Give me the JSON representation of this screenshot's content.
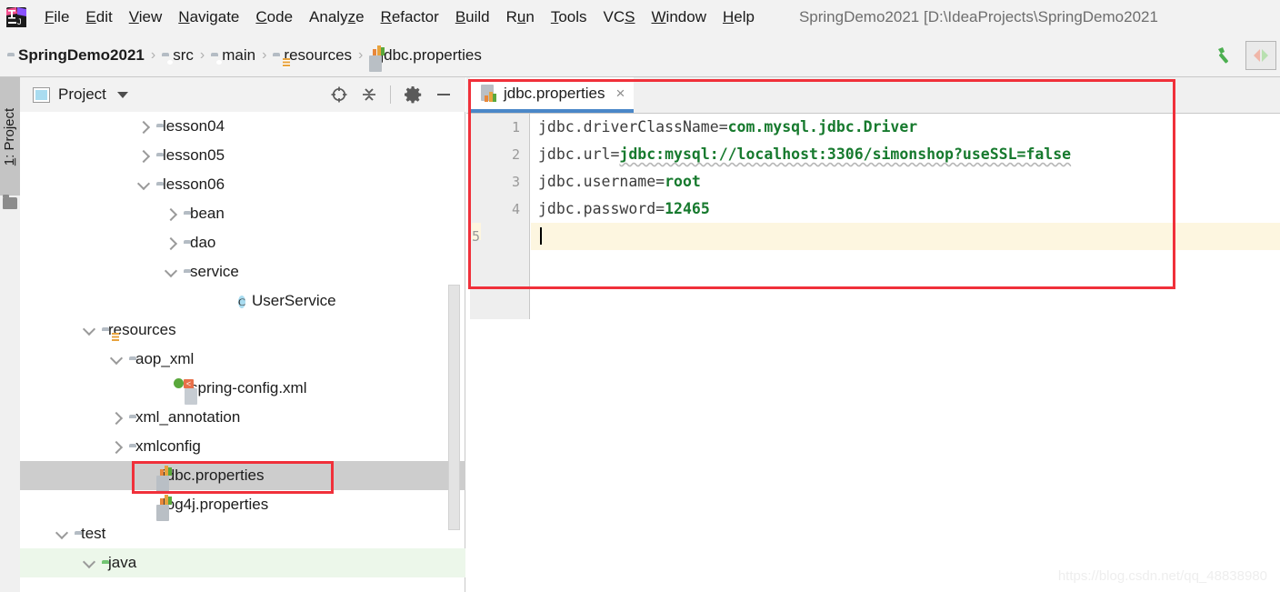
{
  "window": {
    "title": "SpringDemo2021 [D:\\IdeaProjects\\SpringDemo2021",
    "app_icon": "intellij-idea-logo"
  },
  "menubar": {
    "items": [
      {
        "label": "File",
        "mnemonic": "F"
      },
      {
        "label": "Edit",
        "mnemonic": "E"
      },
      {
        "label": "View",
        "mnemonic": "V"
      },
      {
        "label": "Navigate",
        "mnemonic": "N"
      },
      {
        "label": "Code",
        "mnemonic": "C"
      },
      {
        "label": "Analyze",
        "mnemonic": "z"
      },
      {
        "label": "Refactor",
        "mnemonic": "R"
      },
      {
        "label": "Build",
        "mnemonic": "B"
      },
      {
        "label": "Run",
        "mnemonic": "u"
      },
      {
        "label": "Tools",
        "mnemonic": "T"
      },
      {
        "label": "VCS",
        "mnemonic": "S"
      },
      {
        "label": "Window",
        "mnemonic": "W"
      },
      {
        "label": "Help",
        "mnemonic": "H"
      }
    ]
  },
  "navbar": {
    "crumbs": [
      {
        "label": "SpringDemo2021",
        "icon": "module-icon",
        "bold": true
      },
      {
        "label": "src",
        "icon": "folder-icon",
        "bold": false
      },
      {
        "label": "main",
        "icon": "folder-icon",
        "bold": false
      },
      {
        "label": "resources",
        "icon": "resources-icon",
        "bold": false
      },
      {
        "label": "jdbc.properties",
        "icon": "properties-icon",
        "bold": false
      }
    ],
    "separator": "›",
    "actions": [
      {
        "name": "build-hammer-icon"
      },
      {
        "name": "navigate-arrows-button"
      }
    ]
  },
  "toolstrip": {
    "project_tab": "1: Project",
    "project_tab_mnemonic": "1"
  },
  "project_panel": {
    "title": "Project",
    "actions": [
      {
        "name": "locate-target-icon"
      },
      {
        "name": "collapse-all-icon"
      },
      {
        "name": "settings-gear-icon"
      },
      {
        "name": "hide-minimize-icon"
      }
    ],
    "tree": [
      {
        "label": "lesson04",
        "icon": "folder-icon",
        "arrow": "right",
        "indent": 4,
        "state": "normal"
      },
      {
        "label": "lesson05",
        "icon": "folder-icon",
        "arrow": "right",
        "indent": 4,
        "state": "normal"
      },
      {
        "label": "lesson06",
        "icon": "folder-icon",
        "arrow": "down",
        "indent": 4,
        "state": "normal"
      },
      {
        "label": "bean",
        "icon": "folder-icon",
        "arrow": "right",
        "indent": 5,
        "state": "normal"
      },
      {
        "label": "dao",
        "icon": "folder-icon",
        "arrow": "right",
        "indent": 5,
        "state": "normal"
      },
      {
        "label": "service",
        "icon": "folder-icon",
        "arrow": "down",
        "indent": 5,
        "state": "normal"
      },
      {
        "label": "UserService",
        "icon": "java-class-icon",
        "arrow": "none",
        "indent": 7,
        "state": "normal"
      },
      {
        "label": "resources",
        "icon": "resources-icon",
        "arrow": "down",
        "indent": 2,
        "state": "normal"
      },
      {
        "label": "aop_xml",
        "icon": "folder-icon",
        "arrow": "down",
        "indent": 3,
        "state": "normal"
      },
      {
        "label": "spring-config.xml",
        "icon": "spring-xml-icon",
        "arrow": "none",
        "indent": 5,
        "state": "normal"
      },
      {
        "label": "xml_annotation",
        "icon": "folder-icon",
        "arrow": "right",
        "indent": 3,
        "state": "normal"
      },
      {
        "label": "xmlconfig",
        "icon": "folder-icon",
        "arrow": "right",
        "indent": 3,
        "state": "normal"
      },
      {
        "label": "jdbc.properties",
        "icon": "properties-icon",
        "arrow": "none",
        "indent": 4,
        "state": "selected"
      },
      {
        "label": "log4j.properties",
        "icon": "properties-icon",
        "arrow": "none",
        "indent": 4,
        "state": "normal"
      },
      {
        "label": "test",
        "icon": "folder-plain-icon",
        "arrow": "down",
        "indent": 1,
        "state": "normal"
      },
      {
        "label": "java",
        "icon": "folder-green-icon",
        "arrow": "down",
        "indent": 2,
        "state": "testroot"
      }
    ]
  },
  "editor": {
    "tab": {
      "label": "jdbc.properties",
      "icon": "properties-icon",
      "close": "×",
      "active": true
    },
    "line_numbers": [
      "1",
      "2",
      "3",
      "4",
      "5"
    ],
    "caret_line": 5,
    "lines": [
      {
        "key": "jdbc.driverClassName",
        "eq": "=",
        "value": "com.mysql.jdbc.Driver",
        "squiggle": false
      },
      {
        "key": "jdbc.url",
        "eq": "=",
        "value": "jdbc:mysql://localhost:3306/simonshop?useSSL=false",
        "squiggle": true
      },
      {
        "key": "jdbc.username",
        "eq": "=",
        "value": "root",
        "squiggle": false
      },
      {
        "key": "jdbc.password",
        "eq": "=",
        "value": "12465",
        "squiggle": false
      },
      {
        "key": "",
        "eq": "",
        "value": "",
        "squiggle": false
      }
    ]
  },
  "annotations": {
    "editor_box_color": "#f0303a",
    "tree_box_color": "#f0303a"
  },
  "watermark": "https://blog.csdn.net/qq_48838980",
  "colors": {
    "accent_tab_underline": "#4a87c8",
    "value_green": "#177a2e",
    "caret_line_bg": "#fdf6e0",
    "selection_gray": "#cdcdcd",
    "test_root_green": "#ecf7ea",
    "chrome_gray": "#f2f2f2"
  }
}
